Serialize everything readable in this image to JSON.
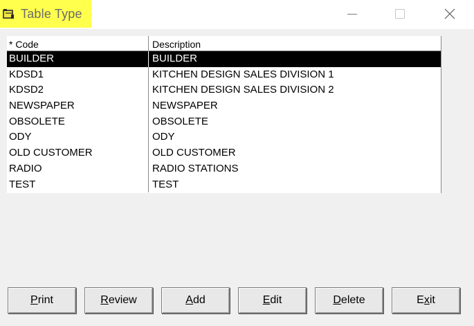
{
  "window": {
    "title": "Table Type",
    "highlight_color": "#ffff4d",
    "icon": "table-icon",
    "controls": [
      "minimize-icon",
      "maximize-icon",
      "close-icon"
    ]
  },
  "grid": {
    "columns": {
      "code": "* Code",
      "description": "Description"
    },
    "rows": [
      {
        "code": "BUILDER",
        "description": "BUILDER",
        "selected": true
      },
      {
        "code": "KDSD1",
        "description": "KITCHEN DESIGN SALES DIVISION 1",
        "selected": false
      },
      {
        "code": "KDSD2",
        "description": "KITCHEN DESIGN SALES DIVISION 2",
        "selected": false
      },
      {
        "code": "NEWSPAPER",
        "description": "NEWSPAPER",
        "selected": false
      },
      {
        "code": "OBSOLETE",
        "description": "OBSOLETE",
        "selected": false
      },
      {
        "code": "ODY",
        "description": "ODY",
        "selected": false
      },
      {
        "code": "OLD CUSTOMER",
        "description": "OLD CUSTOMER",
        "selected": false
      },
      {
        "code": "RADIO",
        "description": "RADIO STATIONS",
        "selected": false
      },
      {
        "code": "TEST",
        "description": "TEST",
        "selected": false
      }
    ]
  },
  "buttons": {
    "print": {
      "accel": "P",
      "rest": "rint"
    },
    "review": {
      "accel": "R",
      "rest": "eview"
    },
    "add": {
      "accel": "A",
      "rest": "dd"
    },
    "edit": {
      "accel": "E",
      "rest": "dit"
    },
    "delete": {
      "accel": "D",
      "rest": "elete"
    },
    "exit": {
      "pre": "E",
      "accel": "x",
      "rest": "it"
    }
  }
}
